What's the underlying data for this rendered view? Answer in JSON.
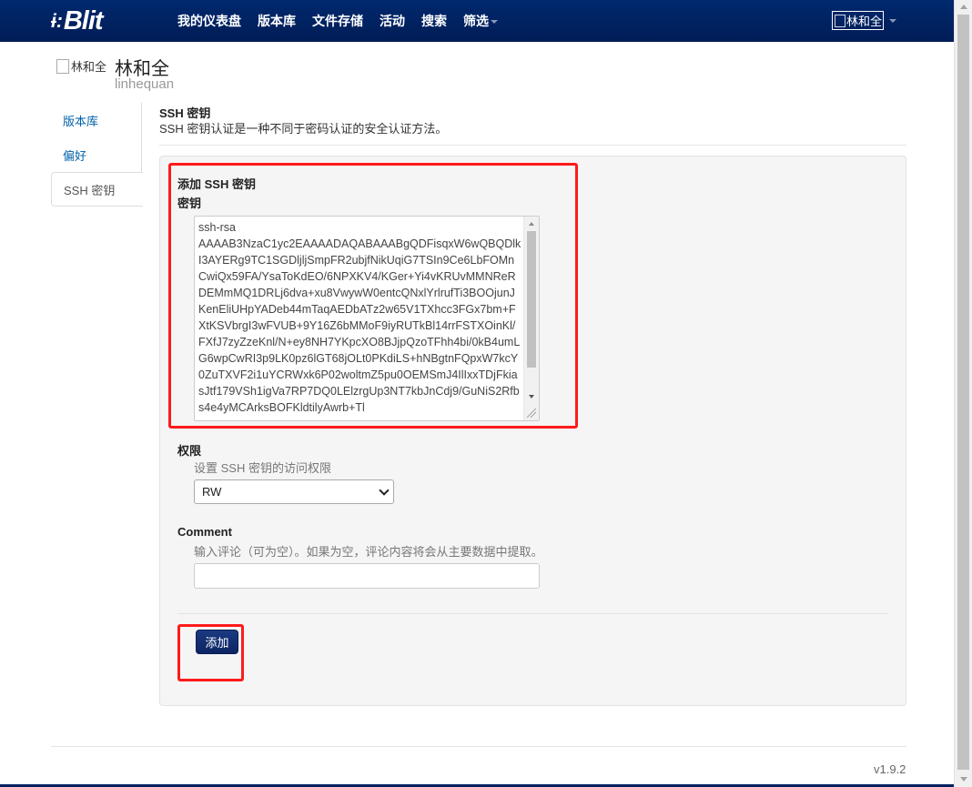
{
  "brand": {
    "mark": "ɨ:",
    "name": "Blit"
  },
  "nav": {
    "items": [
      "我的仪表盘",
      "版本库",
      "文件存储",
      "活动",
      "搜索",
      "筛选"
    ]
  },
  "user_menu": {
    "avatar_alt": "林和全"
  },
  "profile": {
    "avatar_alt": "林和全",
    "name": "林和全",
    "login": "linhequan"
  },
  "side_tabs": [
    "版本库",
    "偏好",
    "SSH 密钥"
  ],
  "ssh_section": {
    "title": "SSH 密钥",
    "description": "SSH 密钥认证是一种不同于密码认证的安全认证方法。"
  },
  "form": {
    "heading": "添加 SSH 密钥",
    "key_label": "密钥",
    "key_value": "ssh-rsa\nAAAAB3NzaC1yc2EAAAADAQABAAABgQDFisqxW6wQBQDlkI3AYERg9TC1SGDljljSmpFR2ubjfNikUqiG7TSIn9Ce6LbFOMnCwiQx59FA/YsaToKdEO/6NPXKV4/KGer+Yi4vKRUvMMNReRDEMmMQ1DRLj6dva+xu8VwywW0entcQNxlYrlrufTi3BOOjunJKenEliUHpYADeb44mTaqAEDbATz2w65V1TXhcc3FGx7bm+FXtKSVbrgI3wFVUB+9Y16Z6bMMoF9iyRUTkBl14rrFSTXOinKl/FXfJ7zyZzeKnl/N+ey8NH7YKpcXO8BJjpQzoTFhh4bi/0kB4umLG6wpCwRI3p9LK0pz6lGT68jOLt0PKdiLS+hNBgtnFQpxW7kcY0ZuTXVF2i1uYCRWxk6P02woltmZ5pu0OEMSmJ4IlIxxTDjFkiasJtf179VSh1igVa7RP7DQ0LElzrgUp3NT7kbJnCdj9/GuNiS2Rfbs4e4yMCArksBOFKldtilyAwrb+Tl",
    "permission_label": "权限",
    "permission_hint": "设置 SSH 密钥的访问权限",
    "permission_value": "RW",
    "comment_label": "Comment",
    "comment_hint": "输入评论（可为空）。如果为空，评论内容将会从主要数据中提取。",
    "comment_value": "",
    "submit_label": "添加"
  },
  "footer": {
    "version": "v1.9.2"
  },
  "colors": {
    "navbar": "#002060",
    "highlight": "#ff1a1a",
    "link": "#0060a8"
  }
}
